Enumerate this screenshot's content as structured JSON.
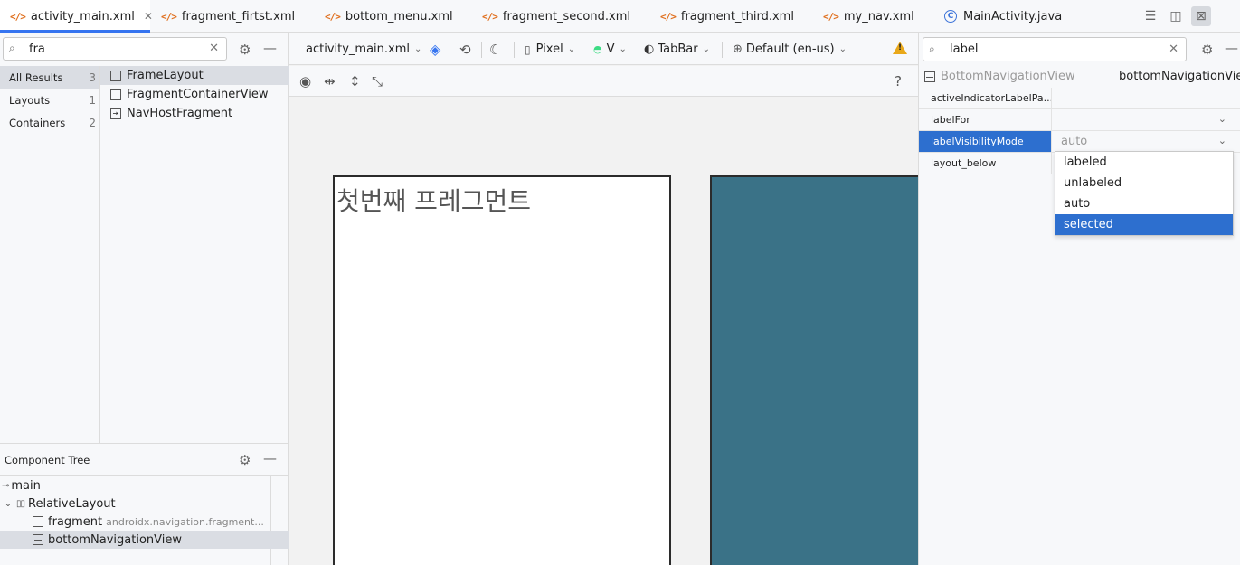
{
  "tabs": [
    {
      "label": "activity_main.xml",
      "icon": "xml-icon",
      "active": true
    },
    {
      "label": "fragment_firtst.xml",
      "icon": "xml-icon"
    },
    {
      "label": "bottom_menu.xml",
      "icon": "xml-icon"
    },
    {
      "label": "fragment_second.xml",
      "icon": "xml-icon"
    },
    {
      "label": "fragment_third.xml",
      "icon": "xml-icon"
    },
    {
      "label": "my_nav.xml",
      "icon": "xml-icon"
    },
    {
      "label": "MainActivity.java",
      "icon": "java-class-icon"
    }
  ],
  "palette": {
    "search_value": "fra",
    "categories": [
      {
        "label": "All Results",
        "count": "3"
      },
      {
        "label": "Layouts",
        "count": "1"
      },
      {
        "label": "Containers",
        "count": "2"
      }
    ],
    "items": [
      {
        "label": "FrameLayout",
        "icon": "frame-layout-icon"
      },
      {
        "label": "FragmentContainerView",
        "icon": "fragment-container-icon"
      },
      {
        "label": "NavHostFragment",
        "icon": "nav-host-icon"
      }
    ]
  },
  "component_tree": {
    "title": "Component Tree",
    "rows": [
      {
        "label": "main",
        "icon": "merge-icon"
      },
      {
        "label": "RelativeLayout",
        "icon": "relative-layout-icon"
      },
      {
        "label": "fragment",
        "sub": "androidx.navigation.fragment...",
        "icon": "fragment-icon"
      },
      {
        "label": "bottomNavigationView",
        "icon": "bottom-nav-icon"
      }
    ]
  },
  "design_toolbar": {
    "file": "activity_main.xml",
    "device": "Pixel",
    "api": "V",
    "theme": "TabBar",
    "locale": "Default (en-us)",
    "help": "?"
  },
  "canvas": {
    "design_text": "첫번째 프레그먼트"
  },
  "attributes": {
    "search_value": "label",
    "component_type": "BottomNavigationView",
    "component_id": "bottomNavigationView",
    "rows": [
      {
        "name": "activeIndicatorLabelPa...",
        "value": ""
      },
      {
        "name": "labelFor",
        "value": ""
      },
      {
        "name": "labelVisibilityMode",
        "value": "auto"
      },
      {
        "name": "layout_below",
        "value": ""
      }
    ],
    "dropdown_options": [
      "labeled",
      "unlabeled",
      "auto",
      "selected"
    ],
    "dropdown_selected": "selected"
  },
  "colors": {
    "accent": "#3574f0",
    "selection": "#2d6fcf",
    "blueprint": "#3a7287",
    "xml_icon": "#e0701f"
  }
}
